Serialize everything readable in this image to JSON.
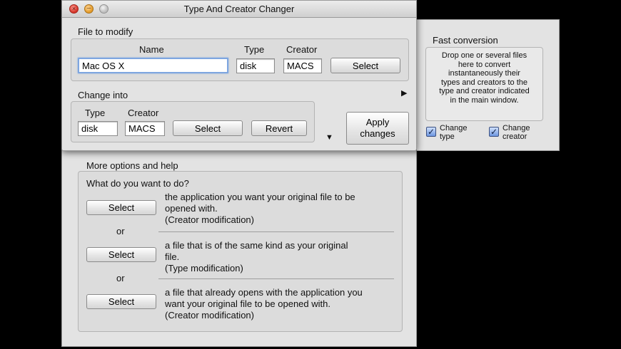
{
  "main_window": {
    "title": "Type And Creator Changer",
    "file_to_modify": {
      "legend": "File to modify",
      "name_label": "Name",
      "type_label": "Type",
      "creator_label": "Creator",
      "name_value": "Mac OS X",
      "type_value": "disk",
      "creator_value": "MACS",
      "select_label": "Select"
    },
    "change_into": {
      "legend": "Change into",
      "type_label": "Type",
      "creator_label": "Creator",
      "type_value": "disk",
      "creator_value": "MACS",
      "select_label": "Select",
      "revert_label": "Revert"
    },
    "apply_label_1": "Apply",
    "apply_label_2": "changes"
  },
  "fast_conversion": {
    "title": "Fast conversion",
    "description": [
      "Drop one or several files",
      "here to convert",
      "instantaneously their",
      "types and creators to the",
      "type and creator indicated",
      "in the main window."
    ],
    "change_type_1": "Change",
    "change_type_2": "type",
    "change_creator_1": "Change",
    "change_creator_2": "creator"
  },
  "more_options": {
    "legend": "More options and help",
    "question": "What do you want to do?",
    "select_label": "Select",
    "or_label": "or",
    "option1": [
      "the application you want your original file to be",
      "opened with.",
      "(Creator modification)"
    ],
    "option2": [
      "a file that is of the same kind as your original",
      "file.",
      "(Type modification)"
    ],
    "option3": [
      "a file that already opens with the application you",
      "want your original file to be opened with.",
      "(Creator modification)"
    ]
  },
  "colors": {
    "accent": "#6d96e0",
    "window_bg": "#e3e3e3",
    "close": "#e0443a",
    "minimize": "#e8a23a"
  }
}
